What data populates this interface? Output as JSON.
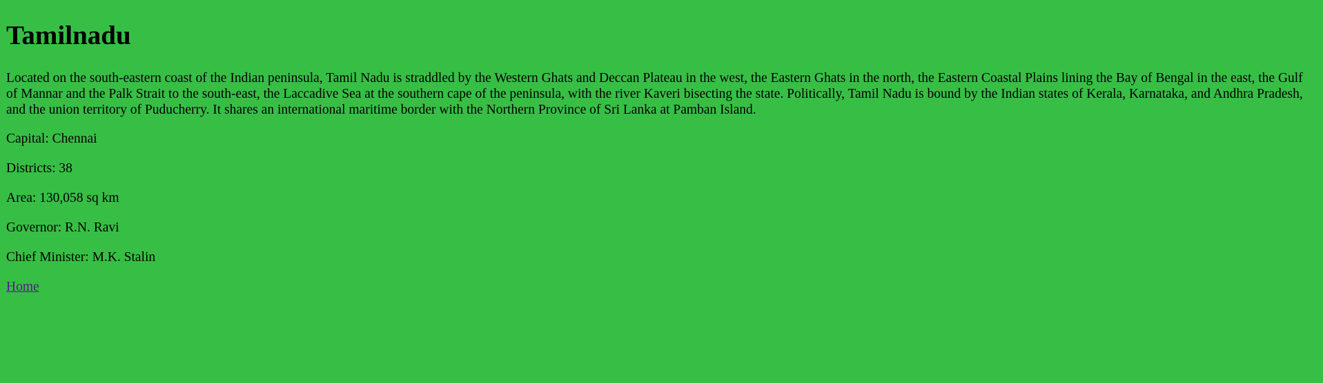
{
  "page": {
    "title": "Tamilnadu",
    "description": "Located on the south-eastern coast of the Indian peninsula, Tamil Nadu is straddled by the Western Ghats and Deccan Plateau in the west, the Eastern Ghats in the north, the Eastern Coastal Plains lining the Bay of Bengal in the east, the Gulf of Mannar and the Palk Strait to the south-east, the Laccadive Sea at the southern cape of the peninsula, with the river Kaveri bisecting the state. Politically, Tamil Nadu is bound by the Indian states of Kerala, Karnataka, and Andhra Pradesh, and the union territory of Puducherry. It shares an international maritime border with the Northern Province of Sri Lanka at Pamban Island.",
    "facts": {
      "capital": "Capital: Chennai",
      "districts": "Districts: 38",
      "area": "Area: 130,058 sq km",
      "governor": "Governor: R.N. Ravi",
      "chief_minister": "Chief Minister: M.K. Stalin"
    },
    "home_link": "Home"
  },
  "colors": {
    "background": "#37bf45",
    "text": "#000000",
    "link": "#551a8b"
  }
}
